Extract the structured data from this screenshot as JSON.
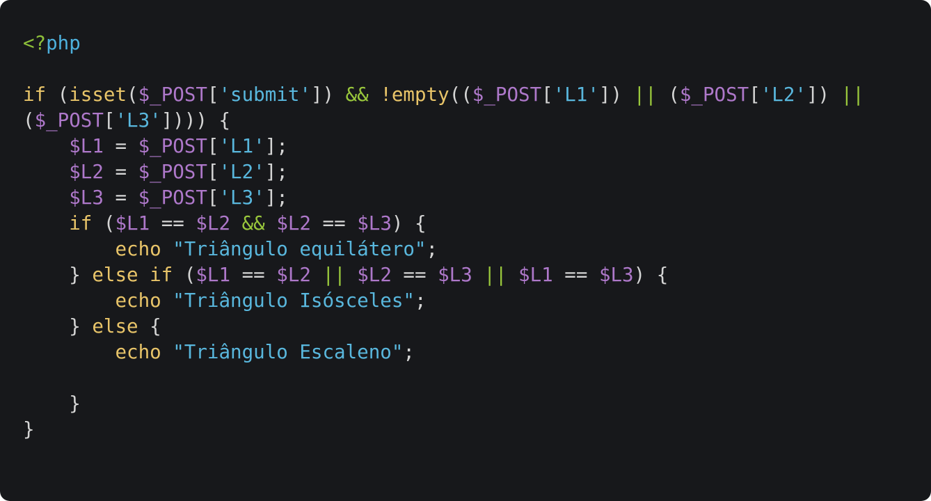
{
  "colors": {
    "background": "#17181b",
    "default": "#d5d5d5",
    "keyword": "#e8c469",
    "variable": "#ae78ca",
    "string": "#59b7dd",
    "operator": "#99c73c",
    "php_tag_bracket": "#8dbf3a",
    "php_tag_name": "#4db0dc"
  },
  "code": {
    "lines": [
      [
        {
          "t": "<?",
          "c": "php_tag_bracket"
        },
        {
          "t": "php",
          "c": "php_tag_name"
        }
      ],
      [],
      [
        {
          "t": "if ",
          "c": "keyword"
        },
        {
          "t": "(",
          "c": "default"
        },
        {
          "t": "isset",
          "c": "keyword"
        },
        {
          "t": "(",
          "c": "default"
        },
        {
          "t": "$_POST",
          "c": "variable"
        },
        {
          "t": "[",
          "c": "default"
        },
        {
          "t": "'submit'",
          "c": "string"
        },
        {
          "t": "]) ",
          "c": "default"
        },
        {
          "t": "&&",
          "c": "operator"
        },
        {
          "t": " ",
          "c": "default"
        },
        {
          "t": "!empty",
          "c": "keyword"
        },
        {
          "t": "((",
          "c": "default"
        },
        {
          "t": "$_POST",
          "c": "variable"
        },
        {
          "t": "[",
          "c": "default"
        },
        {
          "t": "'L1'",
          "c": "string"
        },
        {
          "t": "]) ",
          "c": "default"
        },
        {
          "t": "||",
          "c": "operator"
        },
        {
          "t": " (",
          "c": "default"
        },
        {
          "t": "$_POST",
          "c": "variable"
        },
        {
          "t": "[",
          "c": "default"
        },
        {
          "t": "'L2'",
          "c": "string"
        },
        {
          "t": "]) ",
          "c": "default"
        },
        {
          "t": "||",
          "c": "operator"
        }
      ],
      [
        {
          "t": "(",
          "c": "default"
        },
        {
          "t": "$_POST",
          "c": "variable"
        },
        {
          "t": "[",
          "c": "default"
        },
        {
          "t": "'L3'",
          "c": "string"
        },
        {
          "t": "]))) {",
          "c": "default"
        }
      ],
      [
        {
          "t": "    ",
          "c": "default"
        },
        {
          "t": "$L1",
          "c": "variable"
        },
        {
          "t": " = ",
          "c": "default"
        },
        {
          "t": "$_POST",
          "c": "variable"
        },
        {
          "t": "[",
          "c": "default"
        },
        {
          "t": "'L1'",
          "c": "string"
        },
        {
          "t": "];",
          "c": "default"
        }
      ],
      [
        {
          "t": "    ",
          "c": "default"
        },
        {
          "t": "$L2",
          "c": "variable"
        },
        {
          "t": " = ",
          "c": "default"
        },
        {
          "t": "$_POST",
          "c": "variable"
        },
        {
          "t": "[",
          "c": "default"
        },
        {
          "t": "'L2'",
          "c": "string"
        },
        {
          "t": "];",
          "c": "default"
        }
      ],
      [
        {
          "t": "    ",
          "c": "default"
        },
        {
          "t": "$L3",
          "c": "variable"
        },
        {
          "t": " = ",
          "c": "default"
        },
        {
          "t": "$_POST",
          "c": "variable"
        },
        {
          "t": "[",
          "c": "default"
        },
        {
          "t": "'L3'",
          "c": "string"
        },
        {
          "t": "];",
          "c": "default"
        }
      ],
      [
        {
          "t": "    ",
          "c": "default"
        },
        {
          "t": "if",
          "c": "keyword"
        },
        {
          "t": " (",
          "c": "default"
        },
        {
          "t": "$L1",
          "c": "variable"
        },
        {
          "t": " == ",
          "c": "default"
        },
        {
          "t": "$L2",
          "c": "variable"
        },
        {
          "t": " ",
          "c": "default"
        },
        {
          "t": "&&",
          "c": "operator"
        },
        {
          "t": " ",
          "c": "default"
        },
        {
          "t": "$L2",
          "c": "variable"
        },
        {
          "t": " == ",
          "c": "default"
        },
        {
          "t": "$L3",
          "c": "variable"
        },
        {
          "t": ") {",
          "c": "default"
        }
      ],
      [
        {
          "t": "        ",
          "c": "default"
        },
        {
          "t": "echo",
          "c": "keyword"
        },
        {
          "t": " ",
          "c": "default"
        },
        {
          "t": "\"Triângulo equilátero\"",
          "c": "string"
        },
        {
          "t": ";",
          "c": "default"
        }
      ],
      [
        {
          "t": "    } ",
          "c": "default"
        },
        {
          "t": "else if",
          "c": "keyword"
        },
        {
          "t": " (",
          "c": "default"
        },
        {
          "t": "$L1",
          "c": "variable"
        },
        {
          "t": " == ",
          "c": "default"
        },
        {
          "t": "$L2",
          "c": "variable"
        },
        {
          "t": " ",
          "c": "default"
        },
        {
          "t": "||",
          "c": "operator"
        },
        {
          "t": " ",
          "c": "default"
        },
        {
          "t": "$L2",
          "c": "variable"
        },
        {
          "t": " == ",
          "c": "default"
        },
        {
          "t": "$L3",
          "c": "variable"
        },
        {
          "t": " ",
          "c": "default"
        },
        {
          "t": "||",
          "c": "operator"
        },
        {
          "t": " ",
          "c": "default"
        },
        {
          "t": "$L1",
          "c": "variable"
        },
        {
          "t": " == ",
          "c": "default"
        },
        {
          "t": "$L3",
          "c": "variable"
        },
        {
          "t": ") {",
          "c": "default"
        }
      ],
      [
        {
          "t": "        ",
          "c": "default"
        },
        {
          "t": "echo",
          "c": "keyword"
        },
        {
          "t": " ",
          "c": "default"
        },
        {
          "t": "\"Triângulo Isósceles\"",
          "c": "string"
        },
        {
          "t": ";",
          "c": "default"
        }
      ],
      [
        {
          "t": "    } ",
          "c": "default"
        },
        {
          "t": "else",
          "c": "keyword"
        },
        {
          "t": " {",
          "c": "default"
        }
      ],
      [
        {
          "t": "        ",
          "c": "default"
        },
        {
          "t": "echo",
          "c": "keyword"
        },
        {
          "t": " ",
          "c": "default"
        },
        {
          "t": "\"Triângulo Escaleno\"",
          "c": "string"
        },
        {
          "t": ";",
          "c": "default"
        }
      ],
      [],
      [
        {
          "t": "    }",
          "c": "default"
        }
      ],
      [
        {
          "t": "}",
          "c": "default"
        }
      ]
    ]
  }
}
